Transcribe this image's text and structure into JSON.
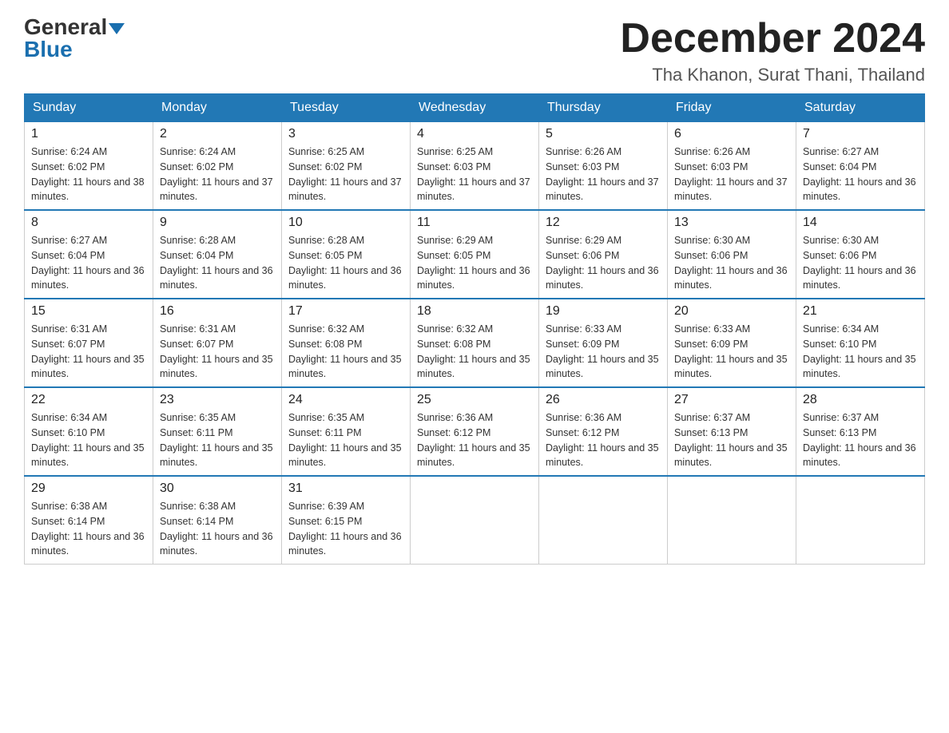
{
  "header": {
    "logo_general": "General",
    "logo_blue": "Blue",
    "month_title": "December 2024",
    "location": "Tha Khanon, Surat Thani, Thailand"
  },
  "days_of_week": [
    "Sunday",
    "Monday",
    "Tuesday",
    "Wednesday",
    "Thursday",
    "Friday",
    "Saturday"
  ],
  "weeks": [
    [
      {
        "day": "1",
        "sunrise": "6:24 AM",
        "sunset": "6:02 PM",
        "daylight": "11 hours and 38 minutes."
      },
      {
        "day": "2",
        "sunrise": "6:24 AM",
        "sunset": "6:02 PM",
        "daylight": "11 hours and 37 minutes."
      },
      {
        "day": "3",
        "sunrise": "6:25 AM",
        "sunset": "6:02 PM",
        "daylight": "11 hours and 37 minutes."
      },
      {
        "day": "4",
        "sunrise": "6:25 AM",
        "sunset": "6:03 PM",
        "daylight": "11 hours and 37 minutes."
      },
      {
        "day": "5",
        "sunrise": "6:26 AM",
        "sunset": "6:03 PM",
        "daylight": "11 hours and 37 minutes."
      },
      {
        "day": "6",
        "sunrise": "6:26 AM",
        "sunset": "6:03 PM",
        "daylight": "11 hours and 37 minutes."
      },
      {
        "day": "7",
        "sunrise": "6:27 AM",
        "sunset": "6:04 PM",
        "daylight": "11 hours and 36 minutes."
      }
    ],
    [
      {
        "day": "8",
        "sunrise": "6:27 AM",
        "sunset": "6:04 PM",
        "daylight": "11 hours and 36 minutes."
      },
      {
        "day": "9",
        "sunrise": "6:28 AM",
        "sunset": "6:04 PM",
        "daylight": "11 hours and 36 minutes."
      },
      {
        "day": "10",
        "sunrise": "6:28 AM",
        "sunset": "6:05 PM",
        "daylight": "11 hours and 36 minutes."
      },
      {
        "day": "11",
        "sunrise": "6:29 AM",
        "sunset": "6:05 PM",
        "daylight": "11 hours and 36 minutes."
      },
      {
        "day": "12",
        "sunrise": "6:29 AM",
        "sunset": "6:06 PM",
        "daylight": "11 hours and 36 minutes."
      },
      {
        "day": "13",
        "sunrise": "6:30 AM",
        "sunset": "6:06 PM",
        "daylight": "11 hours and 36 minutes."
      },
      {
        "day": "14",
        "sunrise": "6:30 AM",
        "sunset": "6:06 PM",
        "daylight": "11 hours and 36 minutes."
      }
    ],
    [
      {
        "day": "15",
        "sunrise": "6:31 AM",
        "sunset": "6:07 PM",
        "daylight": "11 hours and 35 minutes."
      },
      {
        "day": "16",
        "sunrise": "6:31 AM",
        "sunset": "6:07 PM",
        "daylight": "11 hours and 35 minutes."
      },
      {
        "day": "17",
        "sunrise": "6:32 AM",
        "sunset": "6:08 PM",
        "daylight": "11 hours and 35 minutes."
      },
      {
        "day": "18",
        "sunrise": "6:32 AM",
        "sunset": "6:08 PM",
        "daylight": "11 hours and 35 minutes."
      },
      {
        "day": "19",
        "sunrise": "6:33 AM",
        "sunset": "6:09 PM",
        "daylight": "11 hours and 35 minutes."
      },
      {
        "day": "20",
        "sunrise": "6:33 AM",
        "sunset": "6:09 PM",
        "daylight": "11 hours and 35 minutes."
      },
      {
        "day": "21",
        "sunrise": "6:34 AM",
        "sunset": "6:10 PM",
        "daylight": "11 hours and 35 minutes."
      }
    ],
    [
      {
        "day": "22",
        "sunrise": "6:34 AM",
        "sunset": "6:10 PM",
        "daylight": "11 hours and 35 minutes."
      },
      {
        "day": "23",
        "sunrise": "6:35 AM",
        "sunset": "6:11 PM",
        "daylight": "11 hours and 35 minutes."
      },
      {
        "day": "24",
        "sunrise": "6:35 AM",
        "sunset": "6:11 PM",
        "daylight": "11 hours and 35 minutes."
      },
      {
        "day": "25",
        "sunrise": "6:36 AM",
        "sunset": "6:12 PM",
        "daylight": "11 hours and 35 minutes."
      },
      {
        "day": "26",
        "sunrise": "6:36 AM",
        "sunset": "6:12 PM",
        "daylight": "11 hours and 35 minutes."
      },
      {
        "day": "27",
        "sunrise": "6:37 AM",
        "sunset": "6:13 PM",
        "daylight": "11 hours and 35 minutes."
      },
      {
        "day": "28",
        "sunrise": "6:37 AM",
        "sunset": "6:13 PM",
        "daylight": "11 hours and 36 minutes."
      }
    ],
    [
      {
        "day": "29",
        "sunrise": "6:38 AM",
        "sunset": "6:14 PM",
        "daylight": "11 hours and 36 minutes."
      },
      {
        "day": "30",
        "sunrise": "6:38 AM",
        "sunset": "6:14 PM",
        "daylight": "11 hours and 36 minutes."
      },
      {
        "day": "31",
        "sunrise": "6:39 AM",
        "sunset": "6:15 PM",
        "daylight": "11 hours and 36 minutes."
      },
      null,
      null,
      null,
      null
    ]
  ]
}
